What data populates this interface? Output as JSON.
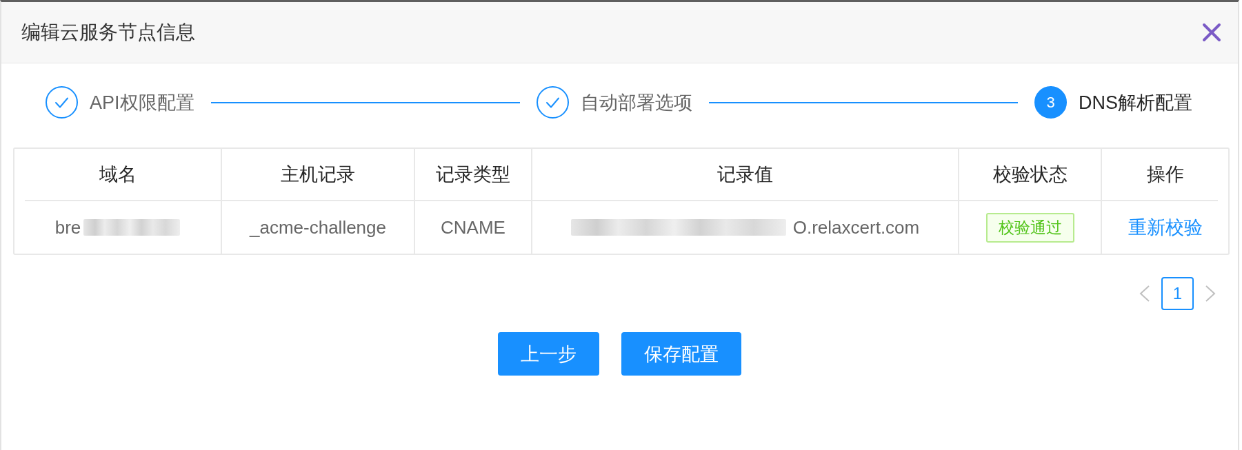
{
  "dialog": {
    "title": "编辑云服务节点信息"
  },
  "steps": [
    {
      "label": "API权限配置",
      "done": true,
      "selected": false
    },
    {
      "label": "自动部署选项",
      "done": true,
      "selected": false
    },
    {
      "label": "DNS解析配置",
      "done": false,
      "selected": true,
      "number": "3"
    }
  ],
  "table": {
    "columns": [
      "域名",
      "主机记录",
      "记录类型",
      "记录值",
      "校验状态",
      "操作"
    ],
    "rows": [
      {
        "domain": {
          "prefix": "bre",
          "redacted": true
        },
        "host": "_acme-challenge",
        "type": "CNAME",
        "value": {
          "redacted": true,
          "suffix": "O.relaxcert.com"
        },
        "status": {
          "label": "校验通过",
          "kind": "success"
        },
        "action": "重新校验"
      }
    ]
  },
  "pagination": {
    "prev_disabled": true,
    "pages": [
      {
        "label": "1",
        "selected": true
      }
    ],
    "next_disabled": true
  },
  "buttons": [
    "上一步",
    "保存配置"
  ]
}
